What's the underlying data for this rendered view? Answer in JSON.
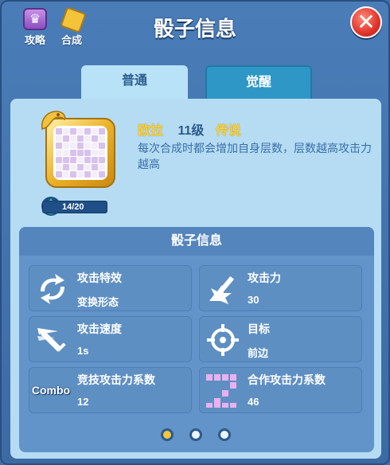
{
  "header": {
    "title": "骰子信息",
    "guide_label": "攻略",
    "merge_label": "合成",
    "close_icon": "close-icon"
  },
  "tabs": [
    {
      "label": "普通",
      "active": true
    },
    {
      "label": "觉醒",
      "active": false
    }
  ],
  "dice": {
    "name": "欧拉",
    "level": "11级",
    "rarity": "传说",
    "description": "每次合成时都会增加自身层数，层数越高攻击力越高",
    "progress_text": "14/20",
    "progress": 0.7
  },
  "stats_section": {
    "title": "骰子信息",
    "items": [
      {
        "name": "攻击特效",
        "value": "变换形态",
        "icon": "transform-arrows-icon"
      },
      {
        "name": "攻击力",
        "value": "30",
        "icon": "sword-burst-icon"
      },
      {
        "name": "攻击速度",
        "value": "1s",
        "icon": "speed-sword-icon"
      },
      {
        "name": "目标",
        "value": "前边",
        "icon": "crosshair-icon"
      },
      {
        "name": "竞技攻击力系数",
        "value": "12",
        "icon_text": "Combo",
        "icon": "combo-icon"
      },
      {
        "name": "合作攻击力系数",
        "value": "46",
        "icon": "coop-grid-icon"
      }
    ]
  },
  "pagination": {
    "count": 3,
    "active": 0
  },
  "colors": {
    "legendary": "#ffd23a",
    "accent_blue": "#2d5a8c",
    "close_red": "#e0332a"
  }
}
